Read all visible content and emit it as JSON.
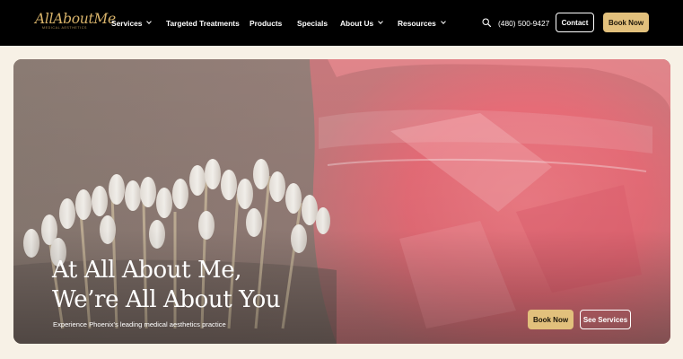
{
  "logo": {
    "text": "AllAboutMe",
    "subtitle": "Medical Aesthetics"
  },
  "nav": {
    "items": [
      {
        "label": "Services",
        "dropdown": true
      },
      {
        "label": "Targeted Treatments",
        "dropdown": false
      },
      {
        "label": "Products",
        "dropdown": false
      },
      {
        "label": "Specials",
        "dropdown": false
      },
      {
        "label": "About Us",
        "dropdown": true
      },
      {
        "label": "Resources",
        "dropdown": true
      }
    ],
    "search_icon": "search-icon",
    "phone": "(480) 500-9427",
    "contact_label": "Contact",
    "book_label": "Book Now"
  },
  "hero": {
    "title_line1": "At All About Me,",
    "title_line2": "We’re All About You",
    "subtitle": "Experience Phoenix's leading medical aesthetics practice",
    "book_label": "Book Now",
    "services_label": "See Services"
  },
  "colors": {
    "nav_bg": "#000000",
    "page_bg": "#f7f1e6",
    "gold_accent": "#e2c07c",
    "logo_gold": "#d8b36a"
  }
}
